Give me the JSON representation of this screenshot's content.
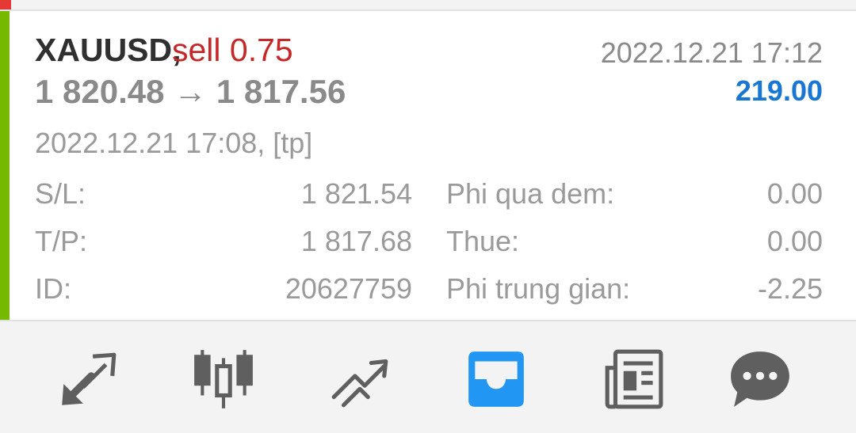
{
  "trade": {
    "symbol": "XAUUSD,",
    "direction": "sell 0.75",
    "price_range": "1 820.48 → 1 817.56",
    "close_time": "2022.12.21 17:12",
    "profit": "219.00",
    "open_info": "2022.12.21 17:08, [tp]"
  },
  "details": [
    {
      "label": "S/L:",
      "value": "1 821.54",
      "label2": "Phi qua dem:",
      "value2": "0.00"
    },
    {
      "label": "T/P:",
      "value": "1 817.68",
      "label2": "Thue:",
      "value2": "0.00"
    },
    {
      "label": "ID:",
      "value": "20627759",
      "label2": "Phi trung gian:",
      "value2": "-2.25"
    }
  ],
  "toolbar": {
    "items": [
      {
        "icon": "quotes-arrows-icon",
        "active": false
      },
      {
        "icon": "candlestick-chart-icon",
        "active": false
      },
      {
        "icon": "trade-trend-icon",
        "active": false
      },
      {
        "icon": "history-inbox-icon",
        "active": true
      },
      {
        "icon": "news-icon",
        "active": false
      },
      {
        "icon": "chat-icon",
        "active": false
      }
    ]
  },
  "colors": {
    "accent_green": "#76b900",
    "sell_red": "#c62828",
    "profit_blue": "#1976d2",
    "icon_grey": "#5f5f5f",
    "active_blue": "#2196f3"
  }
}
